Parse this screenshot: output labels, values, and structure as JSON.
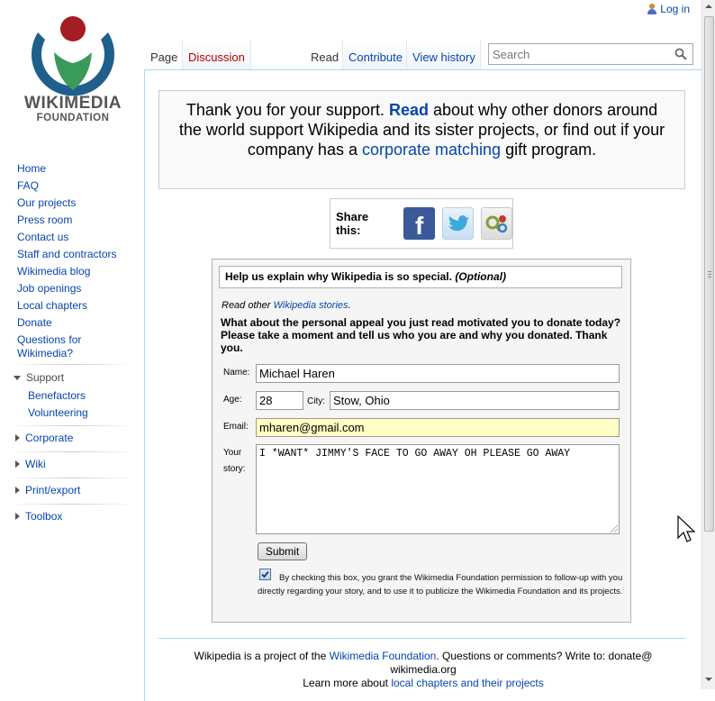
{
  "logo": {
    "name": "WIKIMEDIA",
    "sub": "FOUNDATION"
  },
  "personal": {
    "login_label": "Log in"
  },
  "tabs": {
    "page": "Page",
    "discussion": "Discussion",
    "read": "Read",
    "contribute": "Contribute",
    "history": "View history"
  },
  "search": {
    "placeholder": "Search"
  },
  "sidebar": {
    "items": [
      {
        "label": "Home"
      },
      {
        "label": "FAQ"
      },
      {
        "label": "Our projects"
      },
      {
        "label": "Press room"
      },
      {
        "label": "Contact us"
      },
      {
        "label": "Staff and contractors"
      },
      {
        "label": "Wikimedia blog"
      },
      {
        "label": "Job openings"
      },
      {
        "label": "Local chapters"
      },
      {
        "label": "Donate"
      },
      {
        "label": "Questions for Wikimedia?"
      }
    ],
    "portals": {
      "support": "Support",
      "support_items": [
        "Benefactors",
        "Volunteering"
      ],
      "corporate": "Corporate",
      "wiki": "Wiki",
      "print": "Print/export",
      "toolbox": "Toolbox"
    }
  },
  "thanks": {
    "t1": "Thank you for your support. ",
    "read_link": "Read",
    "t2": " about why other donors around the world support Wikipedia and its sister projects, or find out if your company has a ",
    "corp_link": "corporate matching",
    "t3": " gift program."
  },
  "share": {
    "label": "Share this:",
    "facebook_glyph": "f"
  },
  "form": {
    "heading": "Help us explain why Wikipedia is so special. ",
    "heading_optional": "(Optional)",
    "read_other_prefix": "Read other ",
    "read_other_link": "Wikipedia stories",
    "read_other_suffix": ".",
    "appeal": "What about the personal appeal you just read motivated you to donate today? Please take a moment and tell us who you are and why you donated. Thank you.",
    "name_label": "Name:",
    "name_value": "Michael Haren",
    "age_label": "Age:",
    "age_value": "28",
    "city_label": "City:",
    "city_value": "Stow, Ohio",
    "email_label": "Email:",
    "email_value": "mharen@gmail.com",
    "story_label": "Your story:",
    "story_value": "I *WANT* JIMMY'S FACE TO GO AWAY OH PLEASE GO AWAY",
    "submit_label": "Submit",
    "consent_checked": true,
    "consent_text": "By checking this box, you grant the Wikimedia Foundation permission to follow-up with you directly regarding your story, and to use it to publicize the Wikimedia Foundation and its projects."
  },
  "footer": {
    "f1": "Wikipedia is a project of the ",
    "f_link1": "Wikimedia Foundation",
    "f2": ". Questions or comments? Write to: donate@ wikimedia.org",
    "f3": "Learn more about ",
    "f_link2": "local chapters and their projects"
  },
  "colors": {
    "link": "#0645ad",
    "discussion_link": "#ba0000",
    "logo_blue": "#036",
    "logo_green": "#339966",
    "logo_red": "#990000",
    "email_highlight": "#ffffc4"
  }
}
